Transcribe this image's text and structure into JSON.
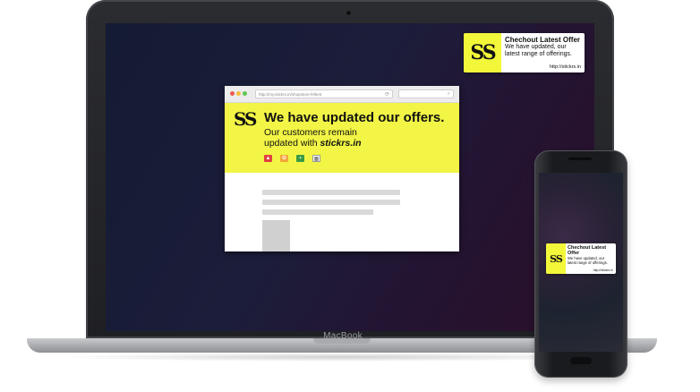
{
  "laptop": {
    "brand_label": "MacBook",
    "notification": {
      "title": "Chechout Latest Offer",
      "message": "We have updated, our latest range of offerings.",
      "url": "http://stickrs.in",
      "logo_text": "SS"
    },
    "browser": {
      "url": "http://my.stickrs.in/shopstore-fellent",
      "reload_icon": "reload-icon",
      "banner": {
        "logo_text": "SS",
        "headline": "We have updated our offers.",
        "subline_1": "Our customers remain",
        "subline_2_prefix": "updated with",
        "brand": "stickrs.in",
        "icons": [
          "shirt-icon",
          "bow-icon",
          "cash-icon",
          "calendar-icon"
        ]
      }
    }
  },
  "phone": {
    "notification": {
      "title": "Chechout Latest Offer",
      "message": "We have updated, our latest range of offerings.",
      "url": "http://stickrs.in",
      "logo_text": "SS"
    }
  },
  "colors": {
    "accent_yellow": "#f2f545",
    "screen_bg": "#1c1d3a"
  }
}
